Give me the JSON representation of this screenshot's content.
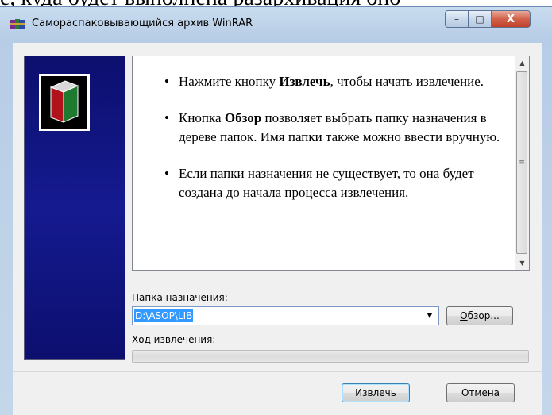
{
  "background_text": "е, куда будет выполнена разархивация оно",
  "window": {
    "title": "Самораспаковывающийся архив WinRAR",
    "controls": {
      "minimize": "–",
      "maximize": "□",
      "close": "X"
    }
  },
  "info": {
    "items": [
      {
        "pre": "Нажмите кнопку ",
        "bold": "Извлечь",
        "post": ", чтобы начать извлечение."
      },
      {
        "pre": "Кнопка ",
        "bold": "Обзор",
        "post": " позволяет выбрать папку назначения в дереве папок. Имя папки также можно ввести вручную."
      },
      {
        "pre": "Если папки назначения не существует, то она будет создана до начала процесса извлечения.",
        "bold": "",
        "post": ""
      }
    ]
  },
  "destination": {
    "label_u": "П",
    "label_rest": "апка назначения:",
    "value": "D:\\ASOP\\LIB",
    "browse_u": "О",
    "browse_rest": "бзор..."
  },
  "progress": {
    "label": "Ход извлечения:",
    "value": 0
  },
  "buttons": {
    "extract": "Извлечь",
    "cancel": "Отмена"
  },
  "icons": {
    "title": "winrar-icon",
    "logo": "winrar-book-icon"
  },
  "colors": {
    "banner": "#151a90",
    "selection": "#3399ff"
  }
}
